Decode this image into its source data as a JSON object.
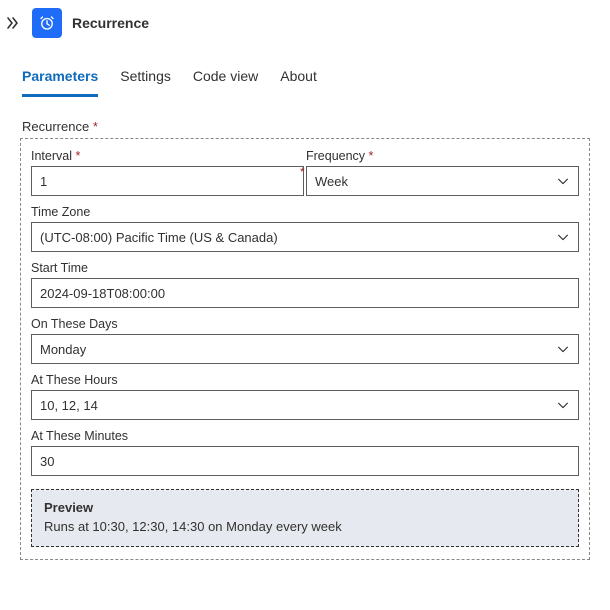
{
  "header": {
    "title": "Recurrence"
  },
  "tabs": {
    "parameters": "Parameters",
    "settings": "Settings",
    "codeview": "Code view",
    "about": "About"
  },
  "section": {
    "label": "Recurrence"
  },
  "fields": {
    "interval": {
      "label": "Interval",
      "value": "1"
    },
    "frequency": {
      "label": "Frequency",
      "value": "Week"
    },
    "timezone": {
      "label": "Time Zone",
      "value": "(UTC-08:00) Pacific Time (US & Canada)"
    },
    "starttime": {
      "label": "Start Time",
      "value": "2024-09-18T08:00:00"
    },
    "days": {
      "label": "On These Days",
      "value": "Monday"
    },
    "hours": {
      "label": "At These Hours",
      "value": "10, 12, 14"
    },
    "minutes": {
      "label": "At These Minutes",
      "value": "30"
    }
  },
  "preview": {
    "title": "Preview",
    "text": "Runs at 10:30, 12:30, 14:30 on Monday every week"
  }
}
